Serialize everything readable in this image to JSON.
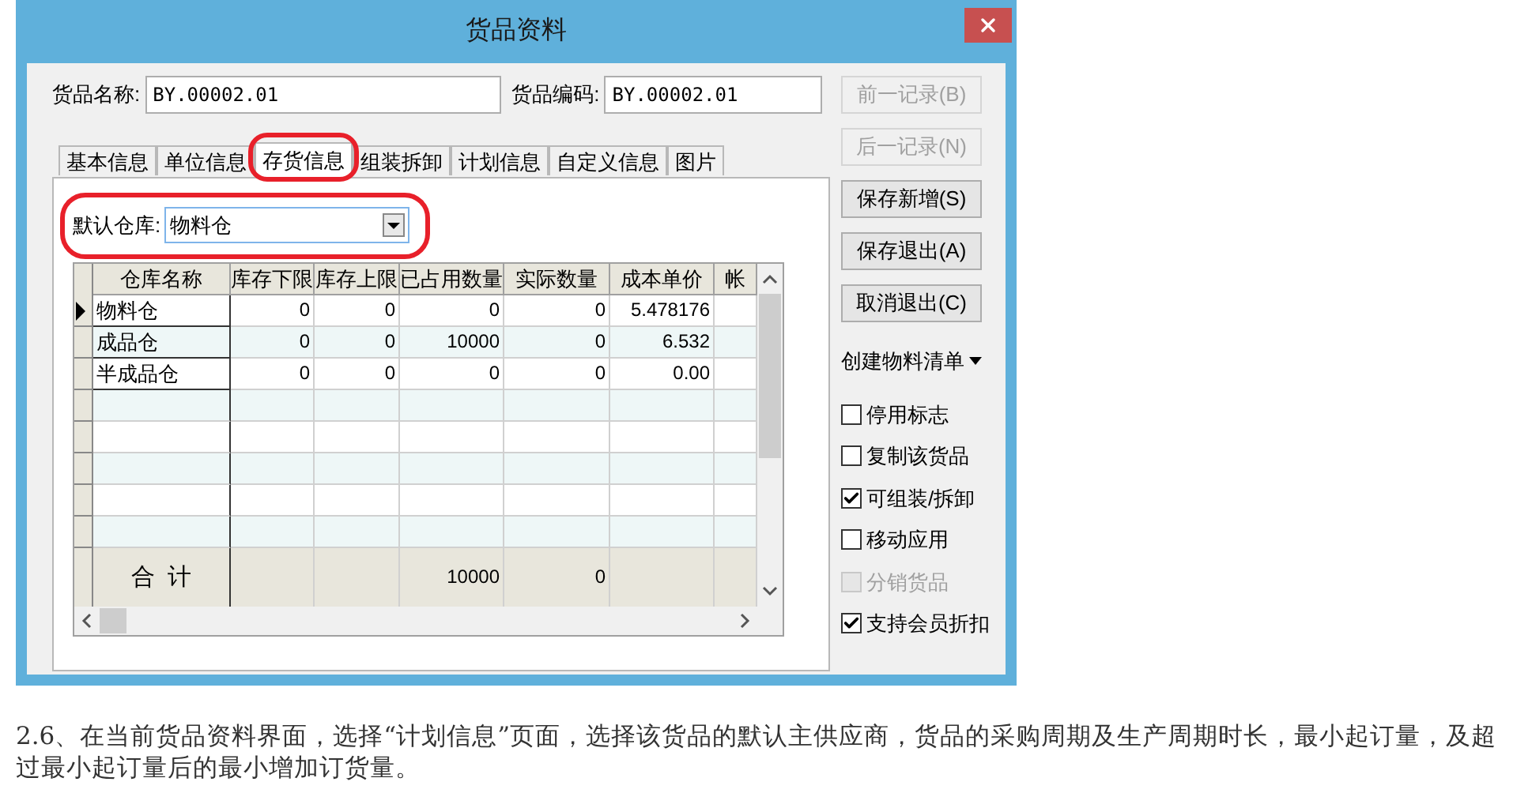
{
  "window": {
    "title": "货品资料"
  },
  "fields": [
    {
      "label": "货品名称:",
      "value": "BY.00002.01"
    },
    {
      "label": "货品编码:",
      "value": "BY.00002.01"
    }
  ],
  "tabs": [
    {
      "label": "基本信息",
      "selected": false,
      "highlighted": false
    },
    {
      "label": "单位信息",
      "selected": false,
      "highlighted": false
    },
    {
      "label": "存货信息",
      "selected": true,
      "highlighted": true
    },
    {
      "label": "组装拆卸",
      "selected": false,
      "highlighted": false
    },
    {
      "label": "计划信息",
      "selected": false,
      "highlighted": false
    },
    {
      "label": "自定义信息",
      "selected": false,
      "highlighted": false
    },
    {
      "label": "图片",
      "selected": false,
      "highlighted": false
    }
  ],
  "default_warehouse": {
    "label": "默认仓库:",
    "value": "物料仓",
    "highlighted": true
  },
  "grid": {
    "columns": [
      "仓库名称",
      "库存下限",
      "库存上限",
      "已占用数量",
      "实际数量",
      "成本单价",
      "帐"
    ],
    "rows": [
      {
        "current": true,
        "cells": [
          "物料仓",
          "0",
          "0",
          "0",
          "0",
          "5.478176",
          ""
        ]
      },
      {
        "current": false,
        "cells": [
          "成品仓",
          "0",
          "0",
          "10000",
          "0",
          "6.532",
          ""
        ]
      },
      {
        "current": false,
        "cells": [
          "半成品仓",
          "0",
          "0",
          "0",
          "0",
          "0.00",
          ""
        ]
      }
    ],
    "totals": {
      "label": "合  计",
      "cells": [
        "",
        "",
        "10000",
        "0",
        "",
        ""
      ]
    }
  },
  "buttons": [
    {
      "label": "前一记录(B)",
      "disabled": true
    },
    {
      "label": "后一记录(N)",
      "disabled": true
    },
    {
      "label": "保存新增(S)",
      "disabled": false
    },
    {
      "label": "保存退出(A)",
      "disabled": false
    },
    {
      "label": "取消退出(C)",
      "disabled": false
    }
  ],
  "menu_button": {
    "label": "创建物料清单"
  },
  "checkboxes": [
    {
      "label": "停用标志",
      "checked": false,
      "disabled": false
    },
    {
      "label": "复制该货品",
      "checked": false,
      "disabled": false
    },
    {
      "label": "可组装/拆卸",
      "checked": true,
      "disabled": false
    },
    {
      "label": "移动应用",
      "checked": false,
      "disabled": false
    },
    {
      "label": "分销货品",
      "checked": false,
      "disabled": true
    },
    {
      "label": "支持会员折扣",
      "checked": true,
      "disabled": false
    }
  ],
  "paragraph": "2.6、在当前货品资料界面，选择“计划信息”页面，选择该货品的默认主供应商，货品的采购周期及生产周期时长，最小起订量，及超过最小起订量后的最小增加订货量。"
}
